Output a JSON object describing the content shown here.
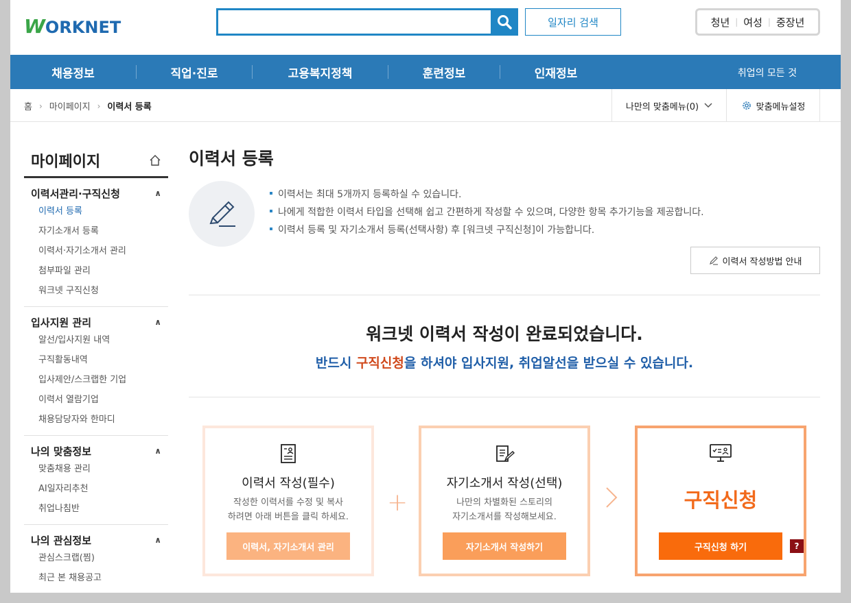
{
  "header": {
    "logo_w": "W",
    "logo_rest": "ORKNET",
    "search_placeholder": "",
    "job_search_label": "일자리 검색",
    "targets": [
      "청년",
      "여성",
      "중장년"
    ]
  },
  "nav": {
    "items": [
      "채용정보",
      "직업·진로",
      "고용복지정책",
      "훈련정보",
      "인재정보"
    ],
    "right": "취업의 모든 것"
  },
  "breadcrumb": {
    "home": "홈",
    "mypage": "마이페이지",
    "current": "이력서 등록",
    "my_menu": "나만의 맞춤메뉴(0)",
    "menu_settings": "맞춤메뉴설정"
  },
  "sidebar": {
    "title": "마이페이지",
    "groups": [
      {
        "title": "이력서관리·구직신청",
        "items": [
          "이력서 등록",
          "자기소개서 등록",
          "이력서·자기소개서 관리",
          "첨부파일 관리",
          "워크넷 구직신청"
        ]
      },
      {
        "title": "입사지원 관리",
        "items": [
          "알선/입사지원 내역",
          "구직활동내역",
          "입사제안/스크랩한 기업",
          "이력서 열람기업",
          "채용담당자와 한마디"
        ]
      },
      {
        "title": "나의 맞춤정보",
        "items": [
          "맞춤채용 관리",
          "AI일자리추천",
          "취업나침반"
        ]
      },
      {
        "title": "나의 관심정보",
        "items": [
          "관심스크랩(찜)",
          "최근 본 채용공고"
        ]
      }
    ]
  },
  "main": {
    "title": "이력서 등록",
    "bullets": [
      "이력서는 최대 5개까지 등록하실 수 있습니다.",
      "나에게 적합한 이력서 타입을 선택해 쉽고 간편하게 작성할 수 있으며, 다양한 항목 추가기능을 제공합니다.",
      "이력서 등록 및 자기소개서 등록(선택사항) 후 [워크넷 구직신청]이 가능합니다."
    ],
    "guide_button": "이력서 작성방법 안내",
    "done_title": "워크넷 이력서 작성이 완료되었습니다.",
    "done_sub_pre": "반드시 ",
    "done_sub_hl": "구직신청",
    "done_sub_post": "을 하셔야 입사지원, 취업알선을 받으실 수 있습니다.",
    "cards": [
      {
        "title": "이력서 작성(필수)",
        "desc1": "작성한 이력서를 수정 및 복사",
        "desc2": "하려면 아래 버튼을 클릭 하세요.",
        "button": "이력서, 자기소개서 관리"
      },
      {
        "title": "자기소개서 작성(선택)",
        "desc1": "나만의 차별화된 스토리의",
        "desc2": "자기소개서를 작성해보세요.",
        "button": "자기소개서 작성하기"
      },
      {
        "title": "구직신청",
        "button": "구직신청 하기",
        "help": "?"
      }
    ],
    "plus": "+"
  }
}
